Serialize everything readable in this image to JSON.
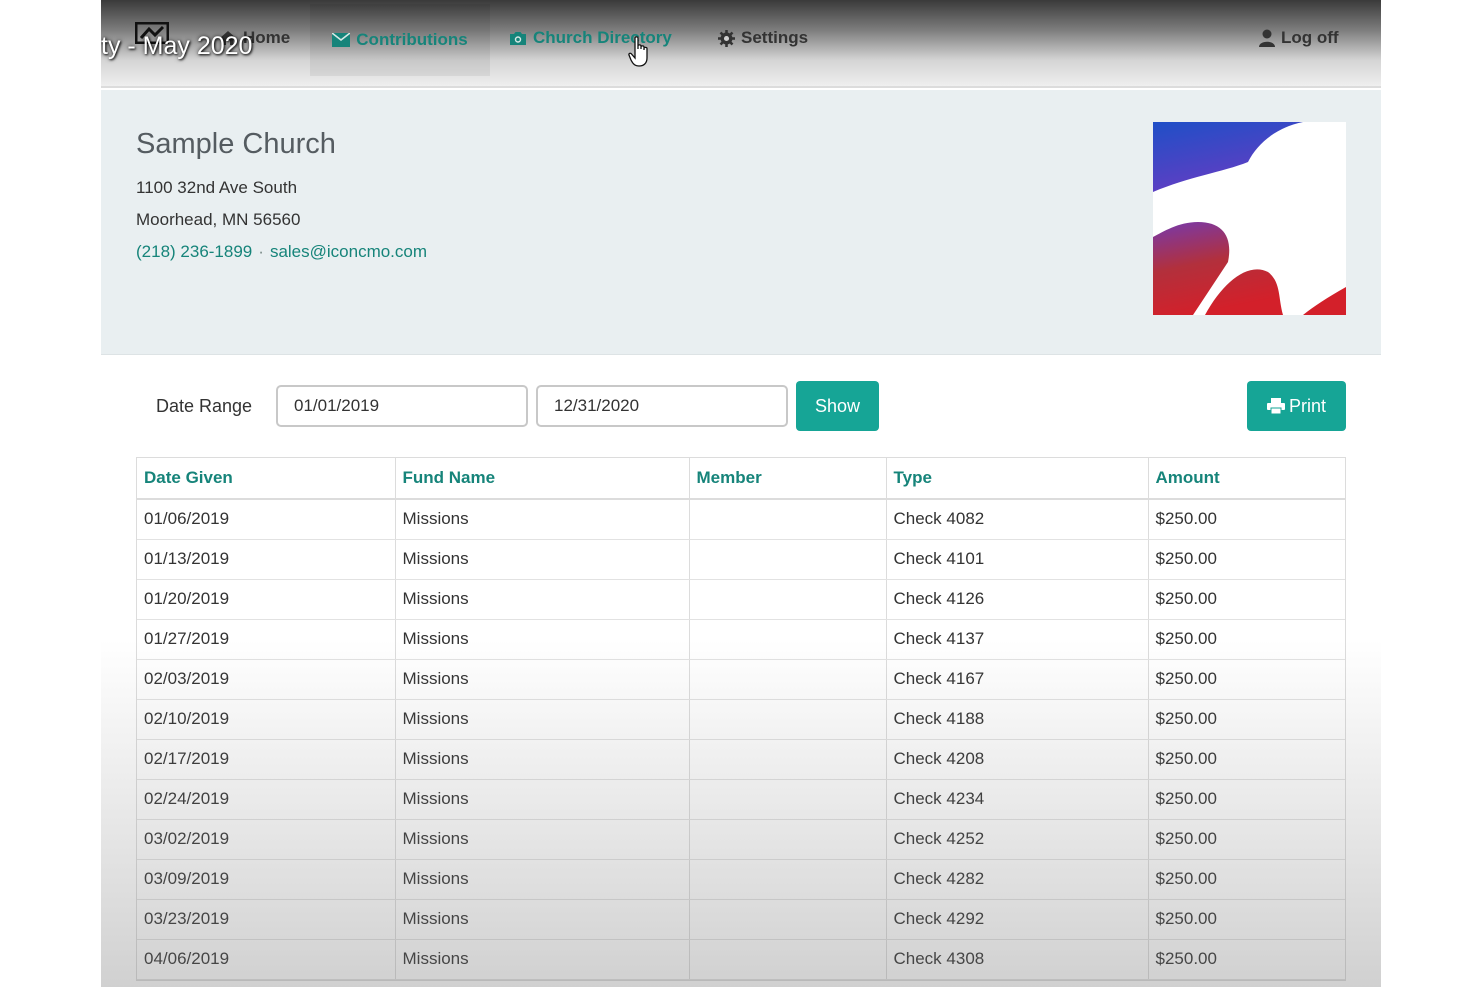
{
  "overlay": {
    "title": "ty - May 2020"
  },
  "nav": {
    "home": "Home",
    "contributions": "Contributions",
    "directory": "Church Directory",
    "settings": "Settings",
    "logoff": "Log off"
  },
  "church": {
    "name": "Sample Church",
    "address1": "1100 32nd Ave South",
    "address2": "Moorhead, MN 56560",
    "phone": "(218) 236-1899",
    "separator": "·",
    "email": "sales@iconcmo.com"
  },
  "filters": {
    "label": "Date Range",
    "from": "01/01/2019",
    "to": "12/31/2020",
    "show_label": "Show",
    "print_label": "Print"
  },
  "table": {
    "columns": [
      "Date Given",
      "Fund Name",
      "Member",
      "Type",
      "Amount"
    ],
    "rows": [
      [
        "01/06/2019",
        "Missions",
        "",
        "Check 4082",
        "$250.00"
      ],
      [
        "01/13/2019",
        "Missions",
        "",
        "Check 4101",
        "$250.00"
      ],
      [
        "01/20/2019",
        "Missions",
        "",
        "Check 4126",
        "$250.00"
      ],
      [
        "01/27/2019",
        "Missions",
        "",
        "Check 4137",
        "$250.00"
      ],
      [
        "02/03/2019",
        "Missions",
        "",
        "Check 4167",
        "$250.00"
      ],
      [
        "02/10/2019",
        "Missions",
        "",
        "Check 4188",
        "$250.00"
      ],
      [
        "02/17/2019",
        "Missions",
        "",
        "Check 4208",
        "$250.00"
      ],
      [
        "02/24/2019",
        "Missions",
        "",
        "Check 4234",
        "$250.00"
      ],
      [
        "03/02/2019",
        "Missions",
        "",
        "Check 4252",
        "$250.00"
      ],
      [
        "03/09/2019",
        "Missions",
        "",
        "Check 4282",
        "$250.00"
      ],
      [
        "03/23/2019",
        "Missions",
        "",
        "Check 4292",
        "$250.00"
      ],
      [
        "04/06/2019",
        "Missions",
        "",
        "Check 4308",
        "$250.00"
      ]
    ]
  },
  "colors": {
    "accent": "#16a596",
    "link": "#16847a",
    "header_bg": "#e9eff1"
  },
  "icons": {
    "home": "home-icon",
    "contributions": "envelope-icon",
    "directory": "camera-icon",
    "settings": "gear-icon",
    "logoff": "user-icon",
    "print": "printer-icon"
  }
}
